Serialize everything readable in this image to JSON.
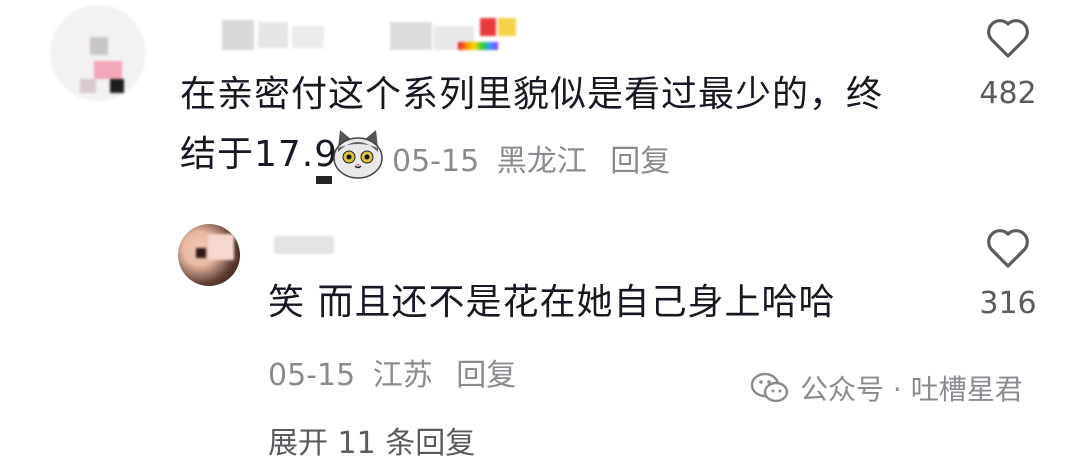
{
  "comment1": {
    "text_line1": "在亲密付这个系列里貌似是看过最少的，终",
    "text_line2": "结于17.9",
    "date": "05-15",
    "location": "黑龙江",
    "reply_label": "回复",
    "likes": "482"
  },
  "comment2": {
    "text": "笑 而且还不是花在她自己身上哈哈",
    "date": "05-15",
    "location": "江苏",
    "reply_label": "回复",
    "likes": "316"
  },
  "expand_replies": "展开 11 条回复",
  "watermark": {
    "text": "公众号 · 吐槽星君"
  },
  "colors": {
    "text": "#161823",
    "meta": "#8a8b91",
    "icon": "#5a5b61"
  },
  "icons": [
    "heart-icon",
    "cat-emoji-icon",
    "wechat-icon"
  ]
}
